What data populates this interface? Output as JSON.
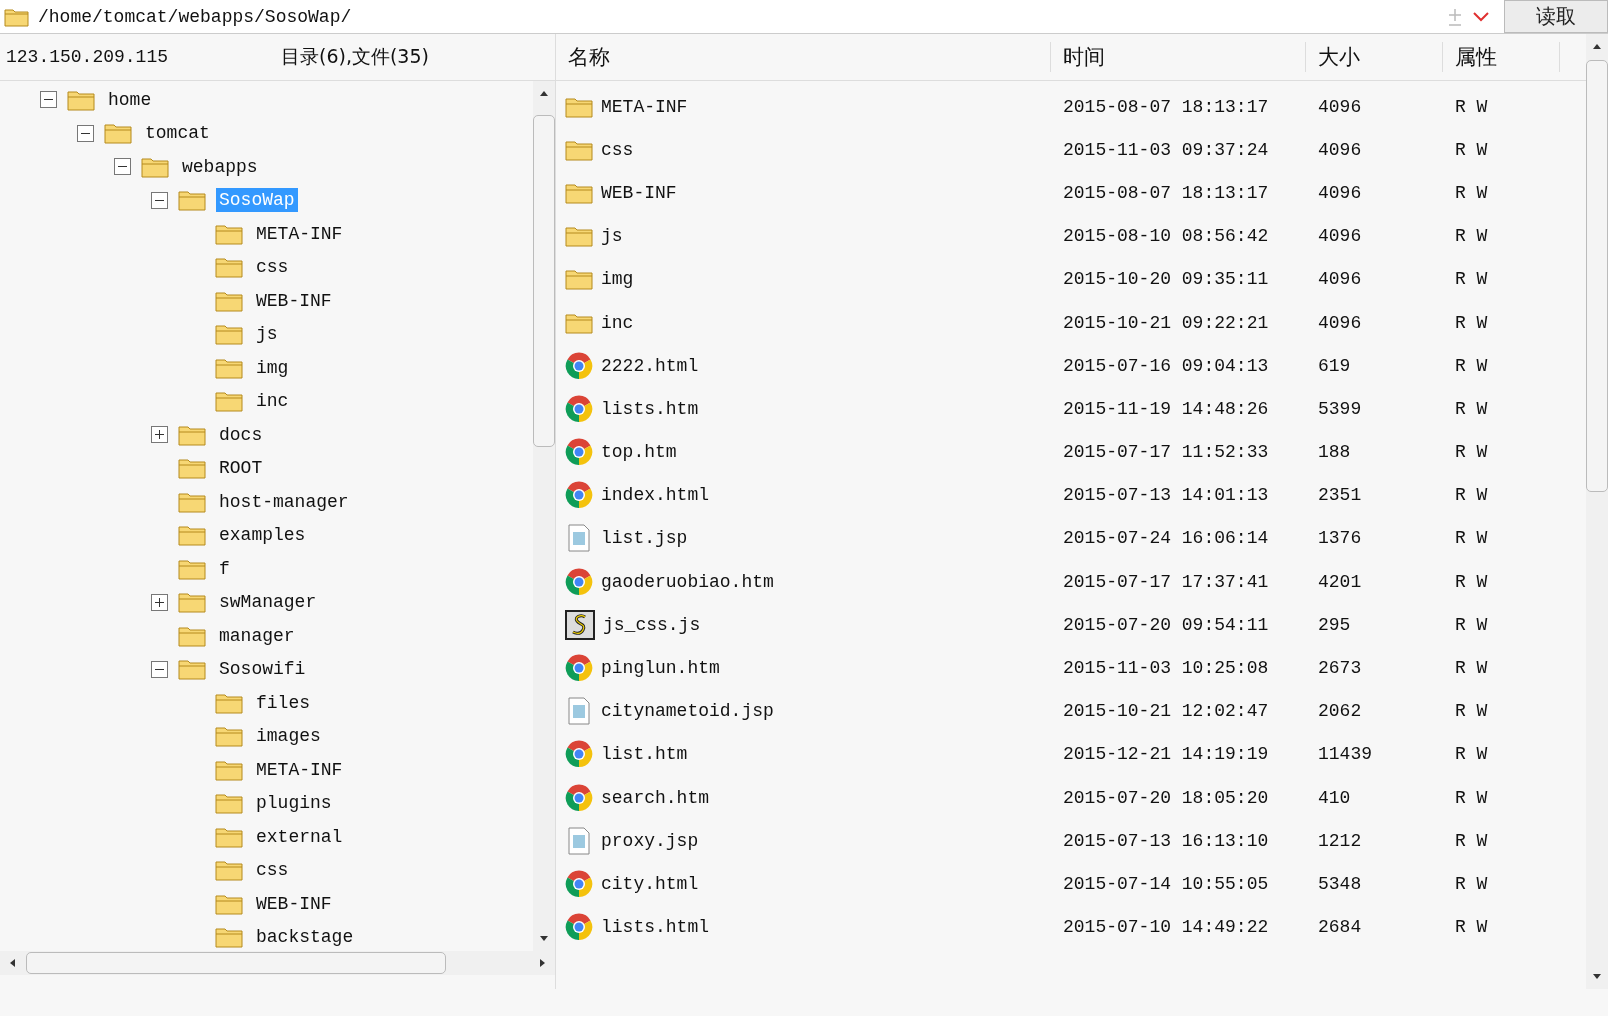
{
  "path_bar": {
    "path": "/home/tomcat/webapps/SosoWap/",
    "read_button": "读取"
  },
  "tree_panel": {
    "host": "123.150.209.115",
    "summary": "目录(6),文件(35)",
    "tree": [
      {
        "name": "home",
        "expanded": true,
        "selected": false,
        "children": [
          {
            "name": "tomcat",
            "expanded": true,
            "selected": false,
            "children": [
              {
                "name": "webapps",
                "expanded": true,
                "selected": false,
                "children": [
                  {
                    "name": "SosoWap",
                    "expanded": true,
                    "selected": true,
                    "children": [
                      {
                        "name": "META-INF",
                        "selected": false
                      },
                      {
                        "name": "css",
                        "selected": false
                      },
                      {
                        "name": "WEB-INF",
                        "selected": false
                      },
                      {
                        "name": "js",
                        "selected": false
                      },
                      {
                        "name": "img",
                        "selected": false
                      },
                      {
                        "name": "inc",
                        "selected": false
                      }
                    ]
                  },
                  {
                    "name": "docs",
                    "expanded": false,
                    "selected": false
                  },
                  {
                    "name": "ROOT",
                    "selected": false
                  },
                  {
                    "name": "host-manager",
                    "selected": false
                  },
                  {
                    "name": "examples",
                    "selected": false
                  },
                  {
                    "name": "f",
                    "selected": false
                  },
                  {
                    "name": "swManager",
                    "expanded": false,
                    "selected": false
                  },
                  {
                    "name": "manager",
                    "selected": false
                  },
                  {
                    "name": "Sosowifi",
                    "expanded": true,
                    "selected": false,
                    "children": [
                      {
                        "name": "files",
                        "selected": false
                      },
                      {
                        "name": "images",
                        "selected": false
                      },
                      {
                        "name": "META-INF",
                        "selected": false
                      },
                      {
                        "name": "plugins",
                        "selected": false
                      },
                      {
                        "name": "external",
                        "selected": false
                      },
                      {
                        "name": "css",
                        "selected": false
                      },
                      {
                        "name": "WEB-INF",
                        "selected": false
                      },
                      {
                        "name": "backstage",
                        "selected": false
                      }
                    ]
                  }
                ]
              }
            ]
          }
        ]
      }
    ]
  },
  "file_list": {
    "columns": [
      "名称",
      "时间",
      "大小",
      "属性"
    ],
    "rows": [
      {
        "kind": "folder",
        "name": "META-INF",
        "time": "2015-08-07 18:13:17",
        "size": "4096",
        "attr": "R W"
      },
      {
        "kind": "folder",
        "name": "css",
        "time": "2015-11-03 09:37:24",
        "size": "4096",
        "attr": "R W"
      },
      {
        "kind": "folder",
        "name": "WEB-INF",
        "time": "2015-08-07 18:13:17",
        "size": "4096",
        "attr": "R W"
      },
      {
        "kind": "folder",
        "name": "js",
        "time": "2015-08-10 08:56:42",
        "size": "4096",
        "attr": "R W"
      },
      {
        "kind": "folder",
        "name": "img",
        "time": "2015-10-20 09:35:11",
        "size": "4096",
        "attr": "R W"
      },
      {
        "kind": "folder",
        "name": "inc",
        "time": "2015-10-21 09:22:21",
        "size": "4096",
        "attr": "R W"
      },
      {
        "kind": "web",
        "name": "2222.html",
        "time": "2015-07-16 09:04:13",
        "size": "619",
        "attr": "R W"
      },
      {
        "kind": "web",
        "name": "lists.htm",
        "time": "2015-11-19 14:48:26",
        "size": "5399",
        "attr": "R W"
      },
      {
        "kind": "web",
        "name": "top.htm",
        "time": "2015-07-17 11:52:33",
        "size": "188",
        "attr": "R W"
      },
      {
        "kind": "web",
        "name": "index.html",
        "time": "2015-07-13 14:01:13",
        "size": "2351",
        "attr": "R W"
      },
      {
        "kind": "file",
        "name": "list.jsp",
        "time": "2015-07-24 16:06:14",
        "size": "1376",
        "attr": "R W"
      },
      {
        "kind": "web",
        "name": "gaoderuobiao.htm",
        "time": "2015-07-17 17:37:41",
        "size": "4201",
        "attr": "R W"
      },
      {
        "kind": "script",
        "name": "js_css.js",
        "time": "2015-07-20 09:54:11",
        "size": "295",
        "attr": "R W"
      },
      {
        "kind": "web",
        "name": "pinglun.htm",
        "time": "2015-11-03 10:25:08",
        "size": "2673",
        "attr": "R W"
      },
      {
        "kind": "file",
        "name": "citynametoid.jsp",
        "time": "2015-10-21 12:02:47",
        "size": "2062",
        "attr": "R W"
      },
      {
        "kind": "web",
        "name": "list.htm",
        "time": "2015-12-21 14:19:19",
        "size": "11439",
        "attr": "R W"
      },
      {
        "kind": "web",
        "name": "search.htm",
        "time": "2015-07-20 18:05:20",
        "size": "410",
        "attr": "R W"
      },
      {
        "kind": "file",
        "name": "proxy.jsp",
        "time": "2015-07-13 16:13:10",
        "size": "1212",
        "attr": "R W"
      },
      {
        "kind": "web",
        "name": "city.html",
        "time": "2015-07-14 10:55:05",
        "size": "5348",
        "attr": "R W"
      },
      {
        "kind": "web",
        "name": "lists.html",
        "time": "2015-07-10 14:49:22",
        "size": "2684",
        "attr": "R W"
      }
    ]
  }
}
